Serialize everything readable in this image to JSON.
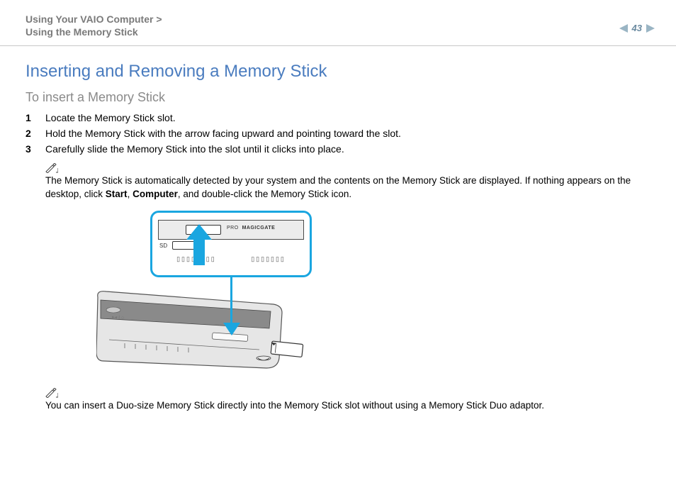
{
  "header": {
    "breadcrumb_line1": "Using Your VAIO Computer >",
    "breadcrumb_line2": "Using the Memory Stick",
    "page_number": "43"
  },
  "title": "Inserting and Removing a Memory Stick",
  "subtitle": "To insert a Memory Stick",
  "steps": [
    {
      "n": "1",
      "text": "Locate the Memory Stick slot."
    },
    {
      "n": "2",
      "text": "Hold the Memory Stick with the arrow facing upward and pointing toward the slot."
    },
    {
      "n": "3",
      "text": "Carefully slide the Memory Stick into the slot until it clicks into place."
    }
  ],
  "note1": {
    "prefix": "The Memory Stick is automatically detected by your system and the contents on the Memory Stick are displayed. If nothing appears on the desktop, click ",
    "bold1": "Start",
    "mid": ", ",
    "bold2": "Computer",
    "suffix": ", and double-click the Memory Stick icon."
  },
  "callout": {
    "pro": "PRO",
    "magicgate": "MAGICGATE",
    "sd": "SD"
  },
  "note2": "You can insert a Duo-size Memory Stick directly into the Memory Stick slot without using a Memory Stick Duo adaptor."
}
